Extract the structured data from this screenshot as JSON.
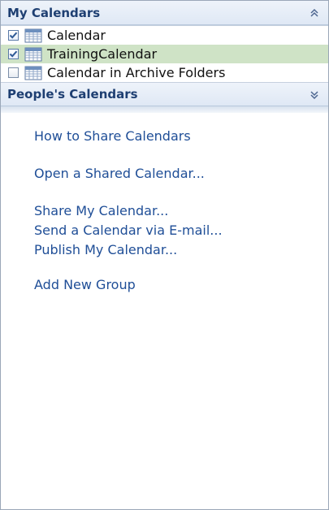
{
  "my_calendars": {
    "header": "My Calendars",
    "collapse_icon": "double-chevron-up-icon",
    "items": [
      {
        "label": "Calendar",
        "checked": true,
        "selected": false
      },
      {
        "label": "TrainingCalendar",
        "checked": true,
        "selected": true
      },
      {
        "label": "Calendar in Archive Folders",
        "checked": false,
        "selected": false
      }
    ]
  },
  "peoples_calendars": {
    "header": "People's Calendars",
    "expand_icon": "double-chevron-down-icon"
  },
  "links": {
    "how_to_share": "How to Share Calendars",
    "open_shared": "Open a Shared Calendar...",
    "share_my": "Share My Calendar...",
    "send_via_email": "Send a Calendar via E-mail...",
    "publish_my": "Publish My Calendar...",
    "add_group": "Add New Group"
  },
  "colors": {
    "link": "#1f4e97",
    "header_text": "#1e3f72",
    "selected_row": "#cfe3c6"
  }
}
